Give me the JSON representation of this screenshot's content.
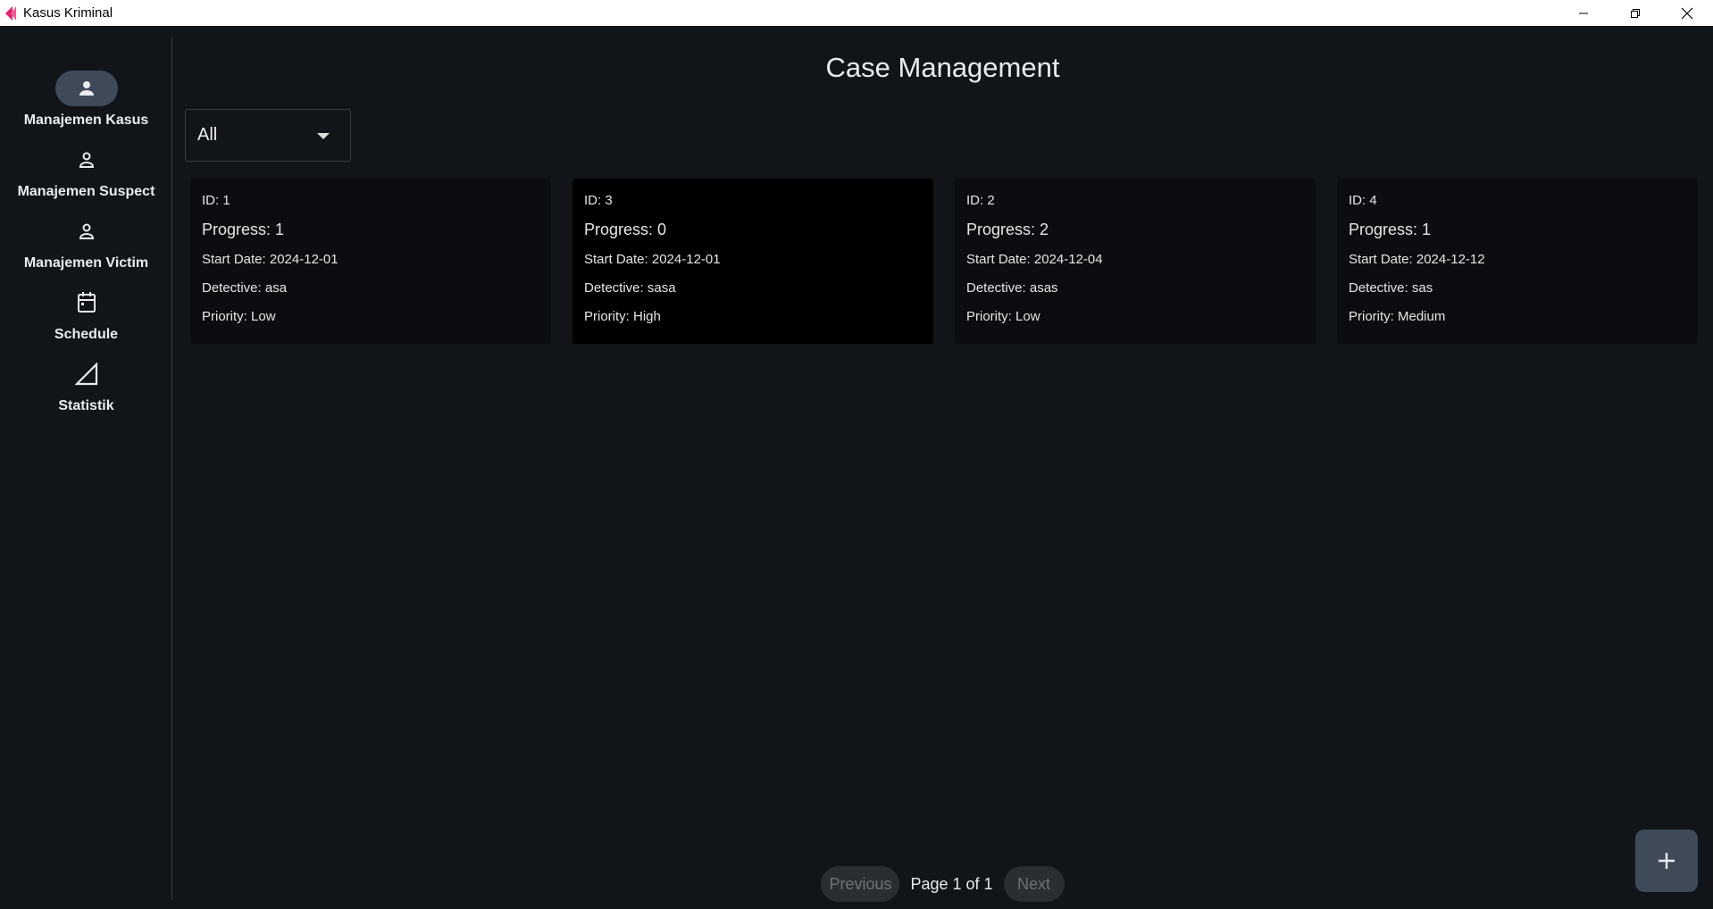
{
  "window": {
    "title": "Kasus Kriminal",
    "controls": [
      "minimize-icon",
      "restore-icon",
      "close-icon"
    ]
  },
  "sidebar": {
    "items": [
      {
        "label": "Manajemen Kasus",
        "icon": "person-icon",
        "active": true
      },
      {
        "label": "Manajemen Suspect",
        "icon": "person-outline-icon",
        "active": false
      },
      {
        "label": "Manajemen Victim",
        "icon": "person-outline-icon",
        "active": false
      },
      {
        "label": "Schedule",
        "icon": "calendar-icon",
        "active": false
      },
      {
        "label": "Statistik",
        "icon": "triangle-icon",
        "active": false
      }
    ]
  },
  "main": {
    "title": "Case Management",
    "filter": {
      "selected": "All"
    },
    "cases": [
      {
        "id": "ID: 1",
        "progress": "Progress: 1",
        "start_date": "Start Date: 2024-12-01",
        "detective": "Detective: asa",
        "priority": "Priority: Low"
      },
      {
        "id": "ID: 3",
        "progress": "Progress: 0",
        "start_date": "Start Date: 2024-12-01",
        "detective": "Detective: sasa",
        "priority": "Priority: High"
      },
      {
        "id": "ID: 2",
        "progress": "Progress: 2",
        "start_date": "Start Date: 2024-12-04",
        "detective": "Detective: asas",
        "priority": "Priority: Low"
      },
      {
        "id": "ID: 4",
        "progress": "Progress: 1",
        "start_date": "Start Date: 2024-12-12",
        "detective": "Detective: sas",
        "priority": "Priority: Medium"
      }
    ]
  },
  "pagination": {
    "previous_label": "Previous",
    "page_info": "Page 1 of 1",
    "next_label": "Next"
  },
  "fab": {
    "icon": "plus-icon"
  },
  "colors": {
    "background": "#111419",
    "accent": "#3f4a58",
    "card": "#0b0d10"
  }
}
